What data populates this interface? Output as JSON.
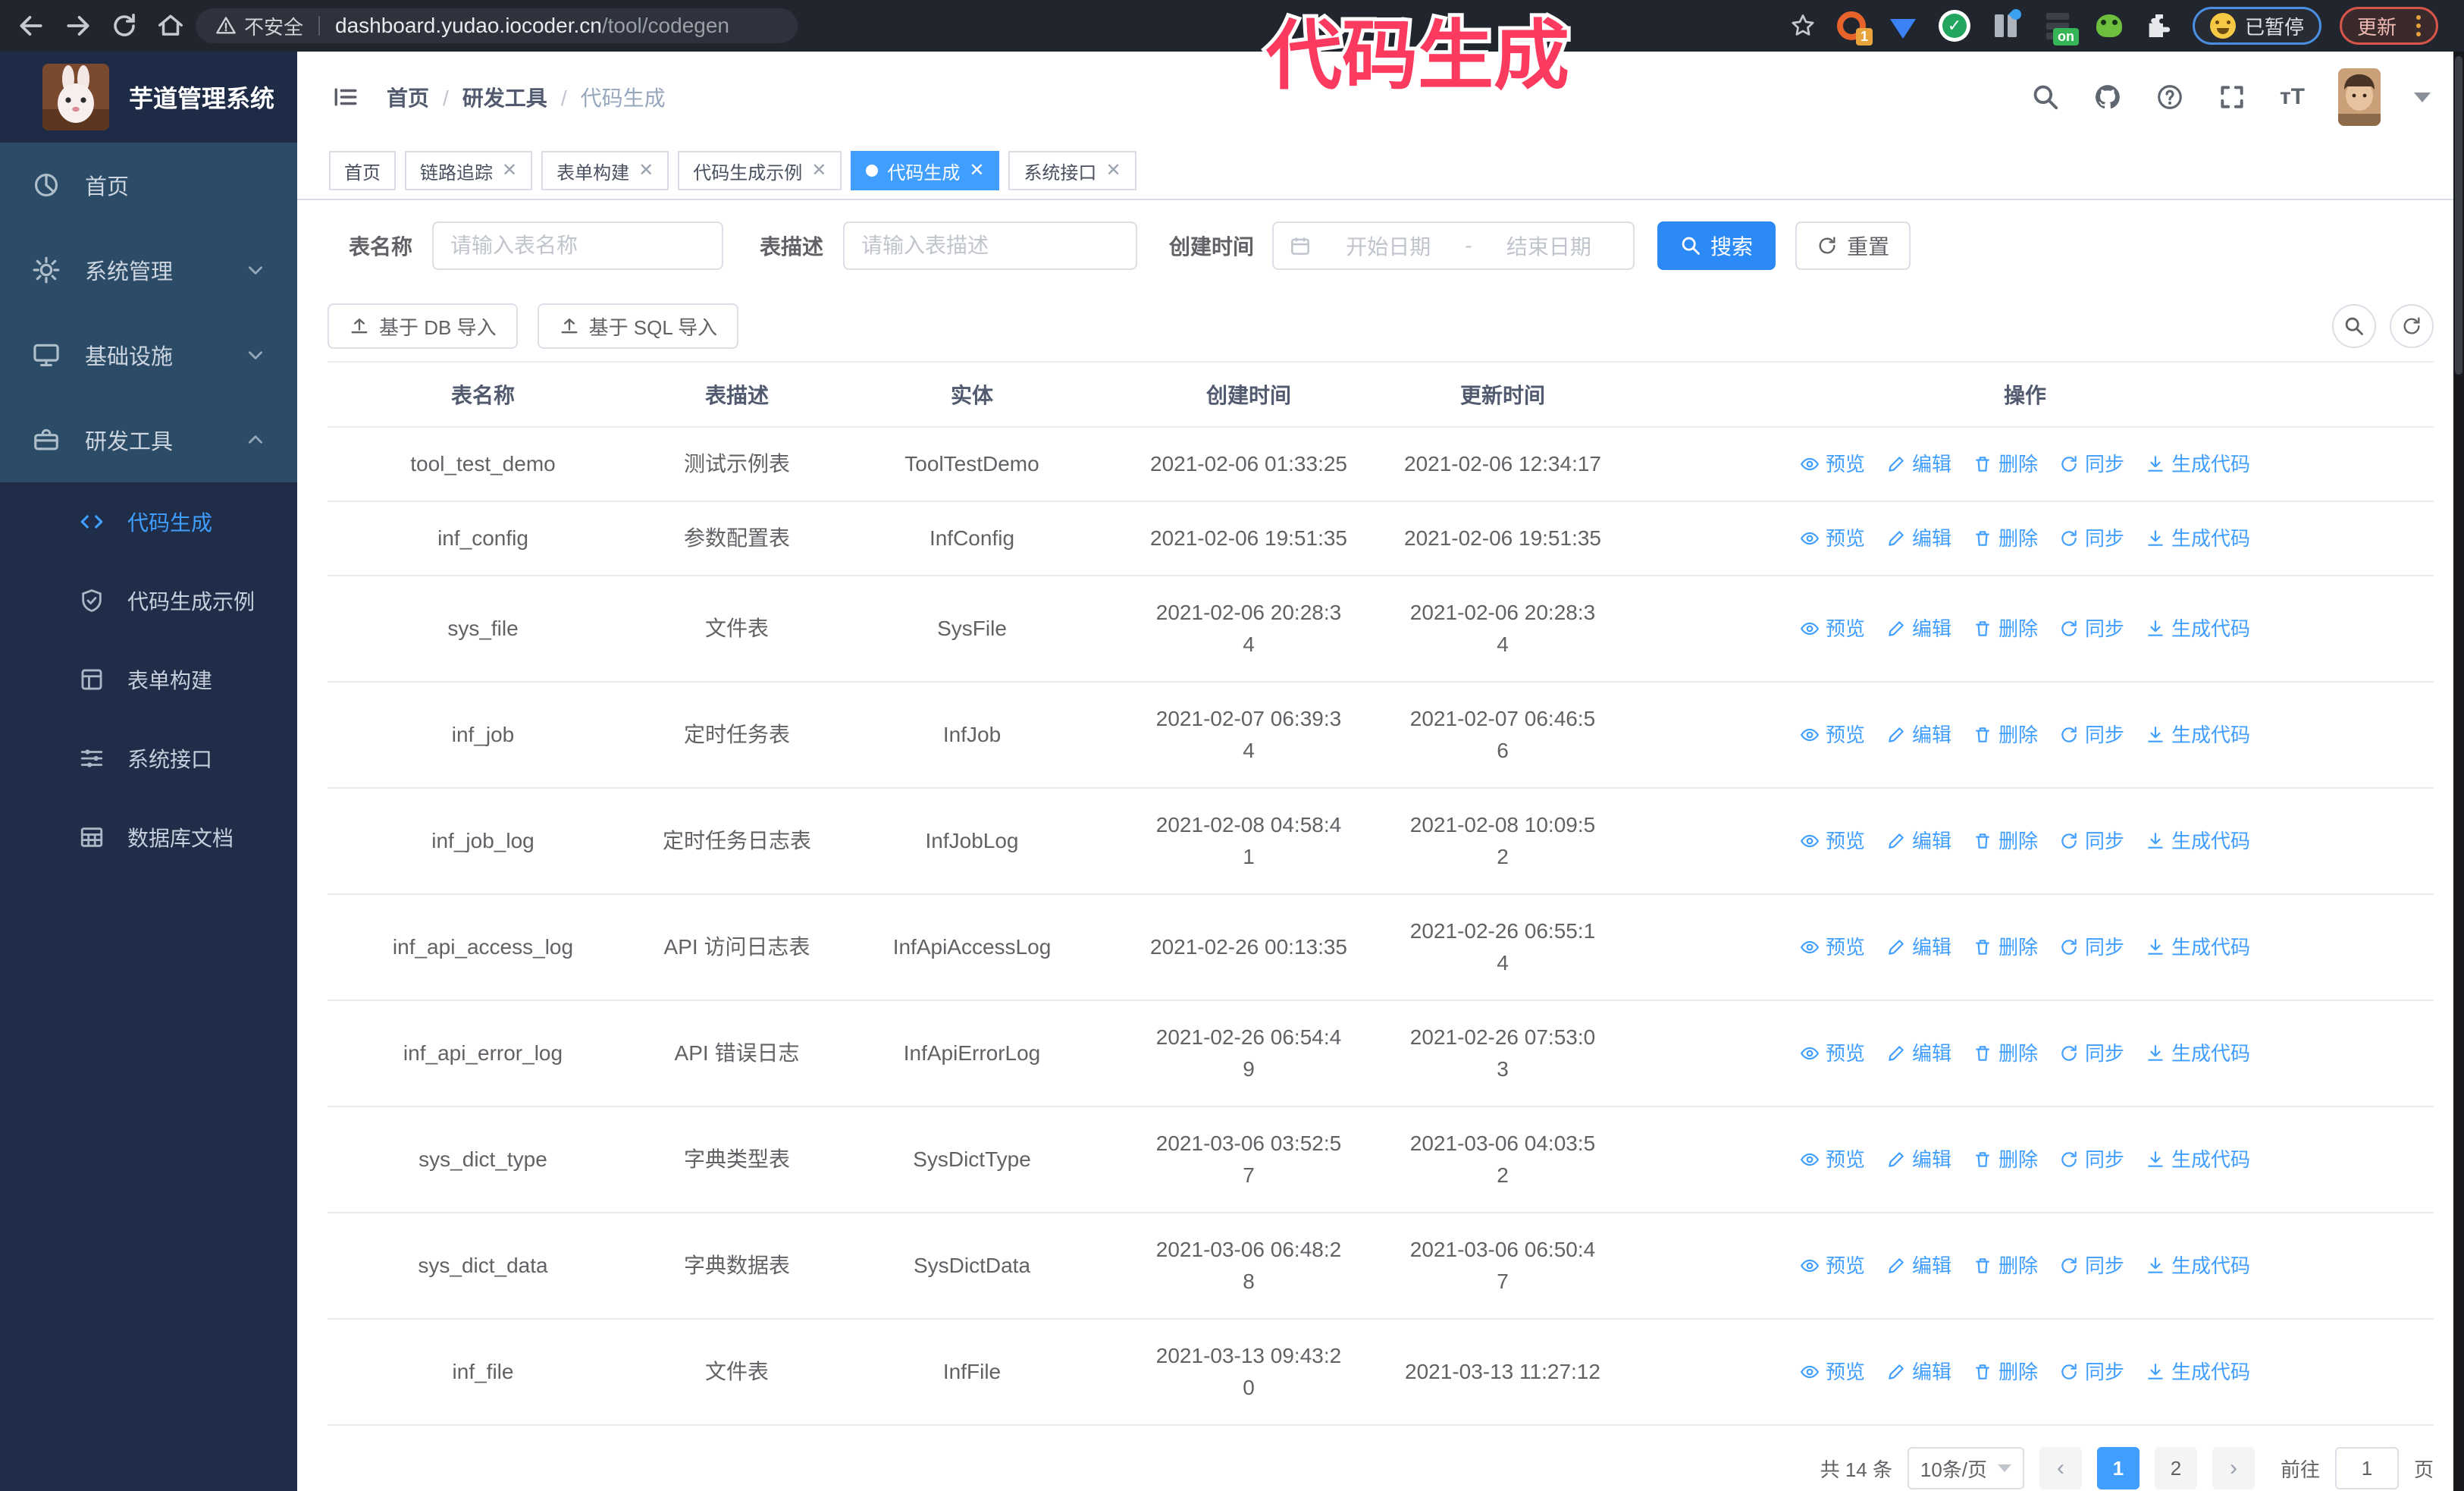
{
  "browser": {
    "security_label": "不安全",
    "url_host": "dashboard.yudao.iocoder.cn",
    "url_path": "/tool/codegen",
    "ext_badge_count": "1",
    "ext_badge_on": "on",
    "paused_button": "已暂停",
    "update_button": "更新"
  },
  "overlay_title": "代码生成",
  "sidebar": {
    "logo_title": "芋道管理系统",
    "items": [
      {
        "label": "首页"
      },
      {
        "label": "系统管理"
      },
      {
        "label": "基础设施"
      },
      {
        "label": "研发工具"
      }
    ],
    "sub_items": [
      {
        "label": "代码生成"
      },
      {
        "label": "代码生成示例"
      },
      {
        "label": "表单构建"
      },
      {
        "label": "系统接口"
      },
      {
        "label": "数据库文档"
      }
    ]
  },
  "header": {
    "breadcrumb": [
      "首页",
      "研发工具",
      "代码生成"
    ]
  },
  "tabs": [
    {
      "label": "首页"
    },
    {
      "label": "链路追踪"
    },
    {
      "label": "表单构建"
    },
    {
      "label": "代码生成示例"
    },
    {
      "label": "代码生成"
    },
    {
      "label": "系统接口"
    }
  ],
  "filters": {
    "table_name_label": "表名称",
    "table_name_placeholder": "请输入表名称",
    "table_desc_label": "表描述",
    "table_desc_placeholder": "请输入表描述",
    "create_time_label": "创建时间",
    "start_date_placeholder": "开始日期",
    "range_separator": "-",
    "end_date_placeholder": "结束日期",
    "search_button": "搜索",
    "reset_button": "重置"
  },
  "toolbar": {
    "db_import_button": "基于 DB 导入",
    "sql_import_button": "基于 SQL 导入"
  },
  "table": {
    "columns": [
      "表名称",
      "表描述",
      "实体",
      "创建时间",
      "更新时间",
      "操作"
    ],
    "actions": [
      "预览",
      "编辑",
      "删除",
      "同步",
      "生成代码"
    ],
    "rows": [
      {
        "name": "tool_test_demo",
        "desc": "测试示例表",
        "entity": "ToolTestDemo",
        "created": "2021-02-06 01:33:25",
        "updated": "2021-02-06 12:34:17"
      },
      {
        "name": "inf_config",
        "desc": "参数配置表",
        "entity": "InfConfig",
        "created": "2021-02-06 19:51:35",
        "updated": "2021-02-06 19:51:35"
      },
      {
        "name": "sys_file",
        "desc": "文件表",
        "entity": "SysFile",
        "created": "2021-02-06 20:28:3\n4",
        "updated": "2021-02-06 20:28:3\n4"
      },
      {
        "name": "inf_job",
        "desc": "定时任务表",
        "entity": "InfJob",
        "created": "2021-02-07 06:39:3\n4",
        "updated": "2021-02-07 06:46:5\n6"
      },
      {
        "name": "inf_job_log",
        "desc": "定时任务日志表",
        "entity": "InfJobLog",
        "created": "2021-02-08 04:58:4\n1",
        "updated": "2021-02-08 10:09:5\n2"
      },
      {
        "name": "inf_api_access_log",
        "desc": "API 访问日志表",
        "entity": "InfApiAccessLog",
        "created": "2021-02-26 00:13:35",
        "updated": "2021-02-26 06:55:1\n4"
      },
      {
        "name": "inf_api_error_log",
        "desc": "API 错误日志",
        "entity": "InfApiErrorLog",
        "created": "2021-02-26 06:54:4\n9",
        "updated": "2021-02-26 07:53:0\n3"
      },
      {
        "name": "sys_dict_type",
        "desc": "字典类型表",
        "entity": "SysDictType",
        "created": "2021-03-06 03:52:5\n7",
        "updated": "2021-03-06 04:03:5\n2"
      },
      {
        "name": "sys_dict_data",
        "desc": "字典数据表",
        "entity": "SysDictData",
        "created": "2021-03-06 06:48:2\n8",
        "updated": "2021-03-06 06:50:4\n7"
      },
      {
        "name": "inf_file",
        "desc": "文件表",
        "entity": "InfFile",
        "created": "2021-03-13 09:43:2\n0",
        "updated": "2021-03-13 11:27:12"
      }
    ]
  },
  "pagination": {
    "total": "共 14 条",
    "page_size": "10条/页",
    "pages": [
      "1",
      "2"
    ],
    "active_page": "1",
    "goto_label": "前往",
    "goto_value": "1",
    "page_unit": "页"
  },
  "colors": {
    "accent_blue": "#409EFF",
    "overlay_pink": "#fb3a5f",
    "sidebar_top": "#2c4b66",
    "sidebar_sub": "#1f2d49"
  }
}
